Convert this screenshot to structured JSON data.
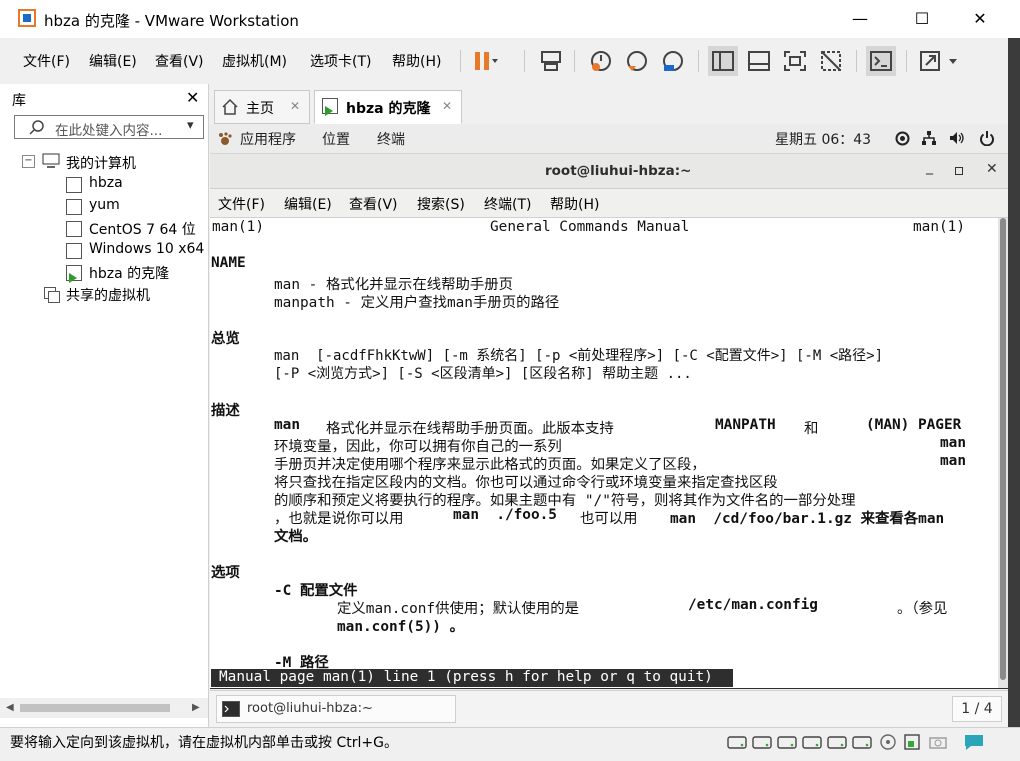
{
  "window": {
    "title": "hbza 的克隆 - VMware Workstation",
    "minimize": "—",
    "maximize": "☐",
    "close": "✕"
  },
  "menu": [
    "文件(F)",
    "编辑(E)",
    "查看(V)",
    "虚拟机(M)",
    "选项卡(T)",
    "帮助(H)"
  ],
  "accent": "#e8792a",
  "library": {
    "title": "库",
    "close": "✕",
    "search_placeholder": "在此处键入内容...",
    "dropdown": "▾",
    "my_computer": "我的计算机",
    "collapse": "−",
    "vms": [
      "hbza",
      "yum",
      "CentOS 7 64 位",
      "Windows 10 x64",
      "hbza 的克隆"
    ],
    "shared": "共享的虚拟机"
  },
  "tabs": [
    {
      "label": "主页",
      "close": "✕"
    },
    {
      "label": "hbza 的克隆",
      "close": "✕"
    }
  ],
  "gnome": {
    "apps": "应用程序",
    "places": "位置",
    "terminal": "终端",
    "clock": "星期五 06：43"
  },
  "terminal": {
    "title": "root@liuhui-hbza:~",
    "menu": [
      "文件(F)",
      "编辑(E)",
      "查看(V)",
      "搜索(S)",
      "终端(T)",
      "帮助(H)"
    ],
    "header_left": "man(1)",
    "header_center": "General Commands Manual",
    "header_right": "man(1)",
    "name_heading": "NAME",
    "name_line1": "man - 格式化并显示在线帮助手册页",
    "name_line2": "manpath - 定义用户查找man手册页的路径",
    "synopsis_heading": "总览",
    "syn_line1": "man  [-acdfFhkKtwW] [-m 系统名] [-p <前处理程序>] [-C <配置文件>] [-M <路径>]",
    "syn_line2": "[-P <浏览方式>] [-S <区段清单>] [区段名称] 帮助主题 ...",
    "desc_heading": "描述",
    "desc_l1a": "man",
    "desc_l1b": "格式化并显示在线帮助手册页面。此版本支持",
    "desc_l1c": "MANPATH",
    "desc_l1d": "和",
    "desc_l1e": "(MAN) PAGER",
    "desc_l2a": "环境变量，因此，你可以拥有你自己的一系列",
    "desc_l2b": "man",
    "desc_l3a": "手册页并决定使用哪个程序来显示此格式的页面。如果定义了区段，",
    "desc_l3b": "man",
    "desc_l4": "将只查找在指定区段内的文档。你也可以通过命令行或环境变量来指定查找区段",
    "desc_l5": "的顺序和预定义将要执行的程序。如果主题中有 \"/\"符号，则将其作为文件名的一部分处理",
    "desc_l6a": "，也就是说你可以用",
    "desc_l6b": "man  ./foo.5",
    "desc_l6c": "也可以用",
    "desc_l6d": "man  /cd/foo/bar.1.gz 来查看各man",
    "desc_l7": "文档。",
    "opt_heading": "选项",
    "opt_c": "-C 配置文件",
    "opt_c_l1a": "定义man.conf供使用；默认使用的是",
    "opt_c_l1b": "/etc/man.config",
    "opt_c_l1c": "。（参见",
    "opt_c_l2": "man.conf(5)) 。",
    "opt_m": "-M 路径",
    "status": "Manual page man(1) line 1 (press h for help or q to quit)"
  },
  "vm_taskbar": {
    "item": "root@liuhui-hbza:~",
    "pager": "1 / 4"
  },
  "statusbar": {
    "message": "要将输入定向到该虚拟机，请在虚拟机内部单击或按 Ctrl+G。"
  }
}
